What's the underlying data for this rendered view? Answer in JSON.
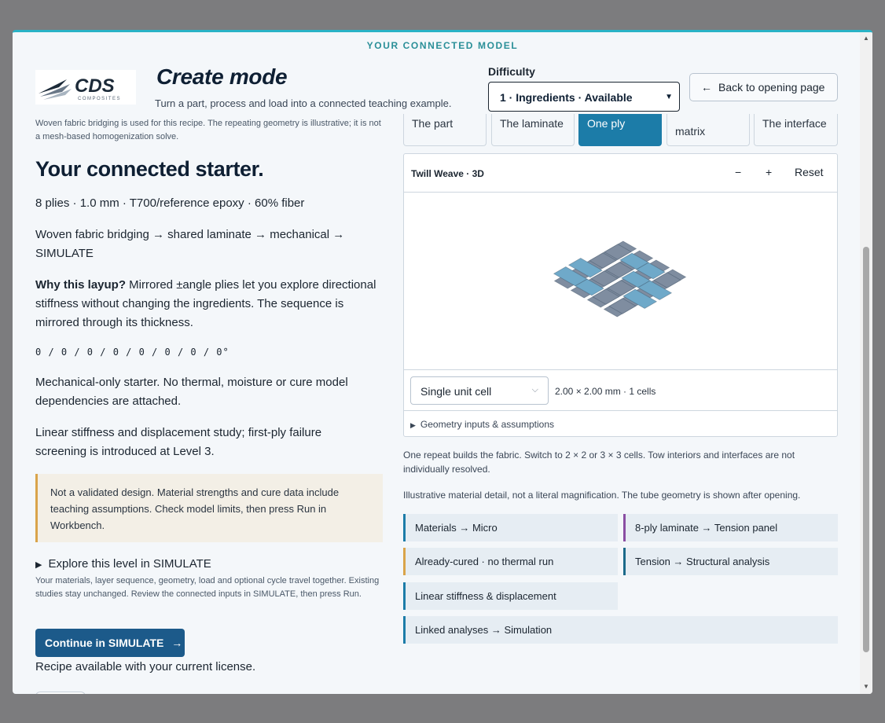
{
  "header": {
    "eyebrow": "YOUR CONNECTED MODEL",
    "title": "Create mode",
    "subtitle": "Turn a part, process and load into a connected teaching example.",
    "logo_text": "CDS",
    "logo_sub": "COMPOSITES",
    "difficulty_label": "Difficulty",
    "difficulty_value": "1 · Ingredients · Available",
    "back_label": "Back to opening page"
  },
  "left": {
    "intro_note": "Woven fabric bridging is used for this recipe. The repeating geometry is illustrative; it is not a mesh-based homogenization solve.",
    "heading": "Your connected starter.",
    "summary": "8 plies · 1.0 mm · T700/reference epoxy · 60% fiber",
    "chain": "Woven fabric bridging → shared laminate → mechanical → SIMULATE",
    "why_label": "Why this layup?",
    "why_text": " Mirrored ±angle plies let you explore directional stiffness without changing the ingredients. The sequence is mirrored through its thickness.",
    "sequence": "0 / 0 / 0 / 0 / 0 / 0 / 0 / 0°",
    "mechanical": "Mechanical-only starter. No thermal, moisture or cure model dependencies are attached.",
    "study": "Linear stiffness and displacement study; first-ply failure screening is introduced at Level 3.",
    "warning": "Not a validated design. Material strengths and cure data include teaching assumptions. Check model limits, then press Run in Workbench.",
    "explore_label": "Explore this level in SIMULATE",
    "explore_note": "Your materials, layer sequence, geometry, load and optional cycle travel together. Existing studies stay unchanged. Review the connected inputs in SIMULATE, then press Run.",
    "continue_label": "Continue in SIMULATE",
    "license": "Recipe available with your current license."
  },
  "tabs": [
    {
      "label": "The part"
    },
    {
      "label": "The laminate"
    },
    {
      "label": "One ply"
    },
    {
      "label": "matrix"
    },
    {
      "label": "The interface"
    }
  ],
  "viewer": {
    "title": "Twill Weave · 3D",
    "zoom_out": "−",
    "zoom_in": "+",
    "reset": "Reset",
    "cell_select": "Single unit cell",
    "dims": "2.00 × 2.00 mm · 1 cells",
    "geometry_toggle": "Geometry inputs & assumptions",
    "colors": {
      "warp": "#6fa9c9",
      "weft": "#7f8da0"
    }
  },
  "notes": {
    "repeat": "One repeat builds the fabric. Switch to 2 × 2 or 3 × 3 cells. Tow interiors and interfaces are not individually resolved.",
    "illustrative": "Illustrative material detail, not a literal magnification. The tube geometry is shown after opening."
  },
  "chips": [
    {
      "label": "Materials → Micro"
    },
    {
      "label": "8-ply laminate → Tension panel"
    },
    {
      "label": "Already-cured · no thermal run"
    },
    {
      "label": "Tension → Structural analysis"
    },
    {
      "label": "Linear stiffness & displacement"
    },
    {
      "label": "Linked analyses → Simulation"
    }
  ]
}
